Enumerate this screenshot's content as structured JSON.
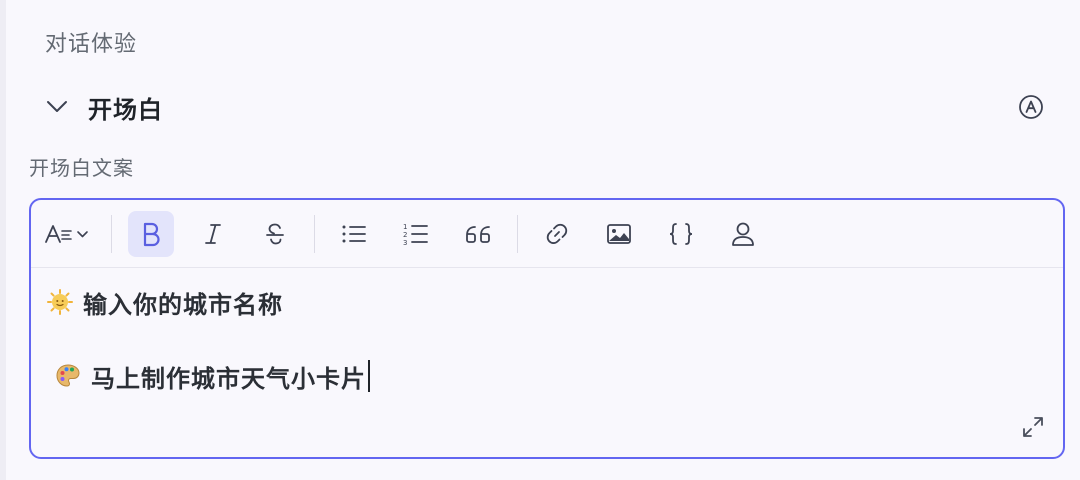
{
  "section": {
    "title": "对话体验"
  },
  "opening": {
    "header_title": "开场白",
    "field_label": "开场白文案",
    "lines": [
      {
        "emoji": "sun-face-icon",
        "text": "输入你的城市名称"
      },
      {
        "emoji": "artist-palette-icon",
        "text": "马上制作城市天气小卡片"
      }
    ]
  },
  "toolbar": {
    "buttons": [
      "font-size-icon",
      "bold-icon",
      "italic-icon",
      "strikethrough-icon",
      "bullet-list-icon",
      "numbered-list-icon",
      "quote-icon",
      "link-icon",
      "image-icon",
      "variable-braces-icon",
      "user-icon"
    ],
    "active": "bold-icon"
  },
  "colors": {
    "accent": "#6366f1",
    "active_bg": "#e3e4fb",
    "label": "#646a73"
  }
}
